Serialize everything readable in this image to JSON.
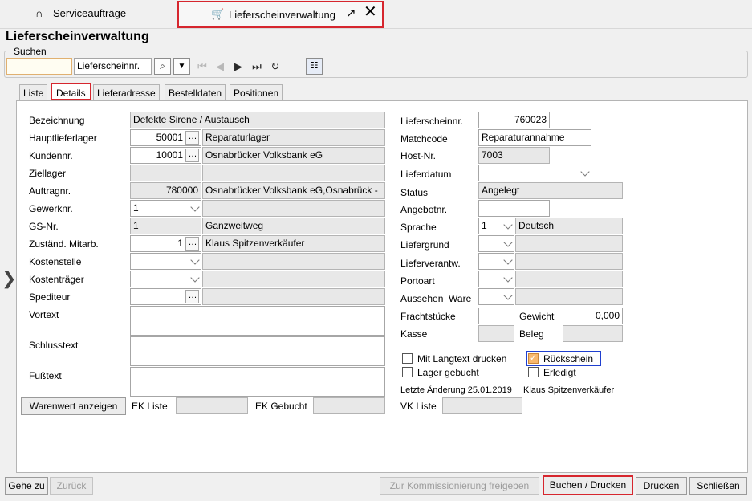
{
  "tabs": {
    "tab1": "Serviceaufträge",
    "tab2": "Lieferscheinverwaltung"
  },
  "page_title": "Lieferscheinverwaltung",
  "search": {
    "label": "Suchen",
    "value": "",
    "field": "Lieferscheinnr."
  },
  "subtabs": [
    "Liste",
    "Details",
    "Lieferadresse",
    "Bestelldaten",
    "Positionen"
  ],
  "left": {
    "bezeichnung_lbl": "Bezeichnung",
    "bezeichnung": "Defekte Sirene / Austausch",
    "hauptlieferlager_lbl": "Hauptlieferlager",
    "hauptlieferlager": "50001",
    "hauptlieferlager_name": "Reparaturlager",
    "kundennr_lbl": "Kundennr.",
    "kundennr": "10001",
    "kunde_name": "Osnabrücker Volksbank eG",
    "ziellager_lbl": "Ziellager",
    "auftragnr_lbl": "Auftragnr.",
    "auftragnr": "780000",
    "auftrag_name": "Osnabrücker Volksbank eG,Osnabrück -",
    "gewerknr_lbl": "Gewerknr.",
    "gewerknr": "1",
    "gsnr_lbl": "GS-Nr.",
    "gsnr": "1",
    "gs_name": "Ganzweitweg",
    "mitarb_lbl": "Zuständ. Mitarb.",
    "mitarb": "1",
    "mitarb_name": "Klaus Spitzenverkäufer",
    "kostenstelle_lbl": "Kostenstelle",
    "kostentraeger_lbl": "Kostenträger",
    "spediteur_lbl": "Spediteur",
    "vortext_lbl": "Vortext",
    "schlusstext_lbl": "Schlusstext",
    "fusstext_lbl": "Fußtext",
    "warenwert_btn": "Warenwert anzeigen",
    "ek_liste_lbl": "EK Liste",
    "ek_gebucht_lbl": "EK Gebucht"
  },
  "right": {
    "lieferscheinnr_lbl": "Lieferscheinnr.",
    "lieferscheinnr": "760023",
    "matchcode_lbl": "Matchcode",
    "matchcode": "Reparaturannahme",
    "hostnr_lbl": "Host-Nr.",
    "hostnr": "7003",
    "lieferdatum_lbl": "Lieferdatum",
    "status_lbl": "Status",
    "status": "Angelegt",
    "angebotnr_lbl": "Angebotnr.",
    "sprache_lbl": "Sprache",
    "sprache": "1",
    "sprache_name": "Deutsch",
    "liefergrund_lbl": "Liefergrund",
    "lieferverantw_lbl": "Lieferverantw.",
    "portoart_lbl": "Portoart",
    "aussehen_lbl": "Aussehen  Ware",
    "frachtstuecke_lbl": "Frachtstücke",
    "gewicht_lbl": "Gewicht",
    "gewicht": "0,000",
    "kasse_lbl": "Kasse",
    "beleg_lbl": "Beleg",
    "cb_langtext": "Mit Langtext drucken",
    "cb_rueckschein": "Rückschein",
    "cb_lager": "Lager gebucht",
    "cb_erledigt": "Erledigt",
    "letzte_aenderung": "Letzte Änderung 25.01.2019",
    "letzte_user": "Klaus Spitzenverkäufer",
    "vk_liste_lbl": "VK Liste"
  },
  "footer": {
    "gehe_zu": "Gehe zu",
    "zurueck": "Zurück",
    "kommission": "Zur Kommissionierung freigeben",
    "buchen": "Buchen / Drucken",
    "drucken": "Drucken",
    "schliessen": "Schließen"
  },
  "colors": {
    "highlight_red": "#d6262e",
    "highlight_blue": "#1f3fcf",
    "checkbox_checked": "#f9b86c"
  }
}
